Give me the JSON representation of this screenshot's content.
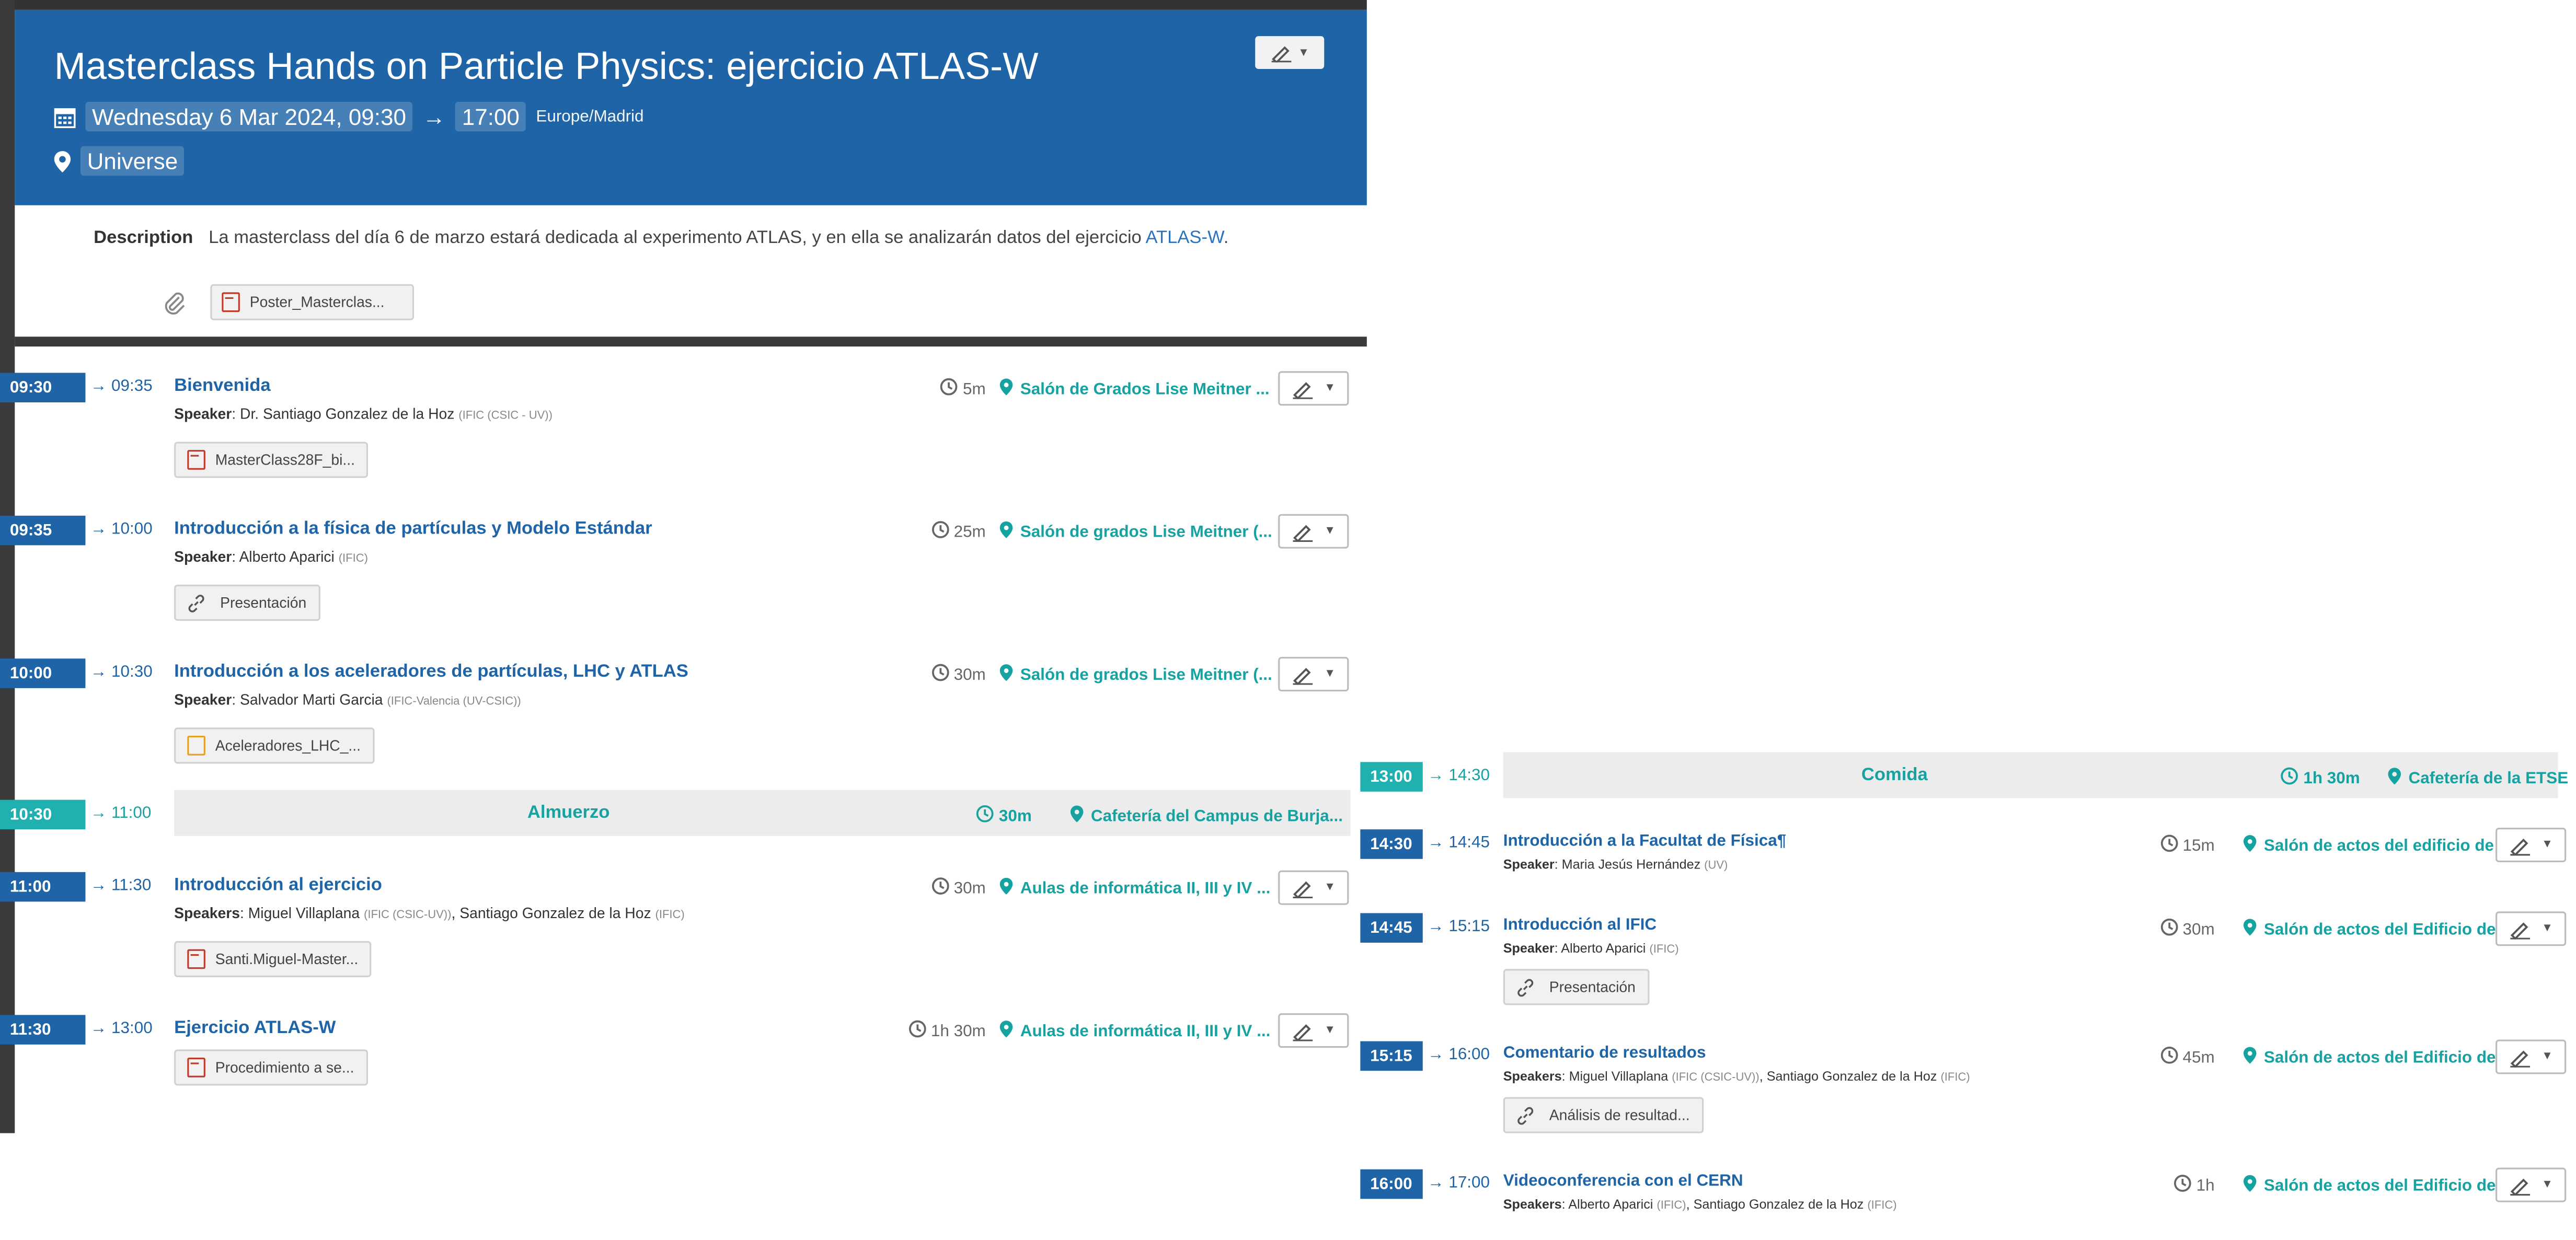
{
  "colors": {
    "header_bg": "#1e64a6",
    "talk_tag": "#1e64a6",
    "break_tag": "#20b0b0",
    "accent_teal": "#17a2a2",
    "link_blue": "#2a72c0"
  },
  "event": {
    "title": "Masterclass Hands on Particle Physics: ejercicio ATLAS-W",
    "date": "Wednesday 6 Mar 2024, 09:30",
    "arrow": "→",
    "end": "17:00",
    "timezone": "Europe/Madrid",
    "location": "Universe",
    "description_label": "Description",
    "description": "La masterclass del día 6 de marzo estará dedicada al experimento ATLAS, y en ella se analizarán datos del ejercicio",
    "description_link": "ATLAS-W",
    "description_end": ".",
    "poster_attachment": "Poster_Masterclas..."
  },
  "left_timetable": [
    {
      "start": "09:30",
      "end": "→ 09:35",
      "title": "Bienvenida",
      "speaker_label": "Speaker",
      "speaker": "Dr. Santiago Gonzalez de la Hoz",
      "speaker_aff": "(IFIC (CSIC - UV))",
      "duration": "5m",
      "location": "Salón de Grados Lise Meitner ...",
      "attachment": "MasterClass28F_bi...",
      "attachment_icon": "pdf-icon"
    },
    {
      "start": "09:35",
      "end": "→ 10:00",
      "title": "Introducción a la física de partículas y Modelo Estándar",
      "speaker_label": "Speaker",
      "speaker": "Alberto Aparici",
      "speaker_aff": "(IFIC)",
      "duration": "25m",
      "location": "Salón de grados Lise Meitner (...",
      "attachment": "Presentación",
      "attachment_icon": "link-icon"
    },
    {
      "start": "10:00",
      "end": "→ 10:30",
      "title": "Introducción a los aceleradores de partículas, LHC y ATLAS",
      "speaker_label": "Speaker",
      "speaker": "Salvador Marti Garcia",
      "speaker_aff": "(IFIC-Valencia (UV-CSIC))",
      "duration": "30m",
      "location": "Salón de grados Lise Meitner (...",
      "attachment": "Aceleradores_LHC_...",
      "attachment_icon": "spreadsheet-icon"
    },
    {
      "start": "10:30",
      "end": "→ 11:00",
      "title": "Almuerzo",
      "duration": "30m",
      "location": "Cafetería del Campus de Burja...",
      "is_break": true
    },
    {
      "start": "11:00",
      "end": "→ 11:30",
      "title": "Introducción al ejercicio",
      "speaker_label": "Speakers",
      "speaker": "Miguel Villaplana",
      "speaker_aff": "(IFIC (CSIC-UV))",
      "speaker2": "Santiago Gonzalez de la Hoz",
      "speaker2_aff": "(IFIC)",
      "duration": "30m",
      "location": "Aulas de informática II, III y IV ...",
      "attachment": "Santi.Miguel-Master...",
      "attachment_icon": "pdf-icon"
    },
    {
      "start": "11:30",
      "end": "→ 13:00",
      "title": "Ejercicio ATLAS-W",
      "duration": "1h 30m",
      "location": "Aulas de informática II, III y IV ...",
      "attachment": "Procedimiento a se...",
      "attachment_icon": "pdf-icon"
    }
  ],
  "right_timetable": [
    {
      "start": "13:00",
      "end": "→ 14:30",
      "title": "Comida",
      "duration": "1h 30m",
      "location": "Cafetería de la ETSE",
      "is_break": true
    },
    {
      "start": "14:30",
      "end": "→ 14:45",
      "title": "Introducción a la Facultat de Física¶",
      "speaker_label": "Speaker",
      "speaker": "Maria Jesús Hernández",
      "speaker_aff": "(UV)",
      "duration": "15m",
      "location": "Salón de actos del edificio de ..."
    },
    {
      "start": "14:45",
      "end": "→ 15:15",
      "title": "Introducción al IFIC",
      "speaker_label": "Speaker",
      "speaker": "Alberto Aparici",
      "speaker_aff": "(IFIC)",
      "duration": "30m",
      "location": "Salón de actos del Edificio de ...",
      "attachment": "Presentación",
      "attachment_icon": "link-icon"
    },
    {
      "start": "15:15",
      "end": "→ 16:00",
      "title": "Comentario de resultados",
      "speaker_label": "Speakers",
      "speaker": "Miguel Villaplana",
      "speaker_aff": "(IFIC (CSIC-UV))",
      "speaker2": "Santiago Gonzalez de la Hoz",
      "speaker2_aff": "(IFIC)",
      "duration": "45m",
      "location": "Salón de actos del Edificio de ...",
      "attachment": "Análisis de resultad...",
      "attachment_icon": "link-icon"
    },
    {
      "start": "16:00",
      "end": "→ 17:00",
      "title": "Videoconferencia con el CERN",
      "speaker_label": "Speakers",
      "speaker": "Alberto Aparici",
      "speaker_aff": "(IFIC)",
      "speaker2": "Santiago Gonzalez de la Hoz",
      "speaker2_aff": "(IFIC)",
      "duration": "1h",
      "location": "Salón de actos del Edificio de ..."
    }
  ]
}
